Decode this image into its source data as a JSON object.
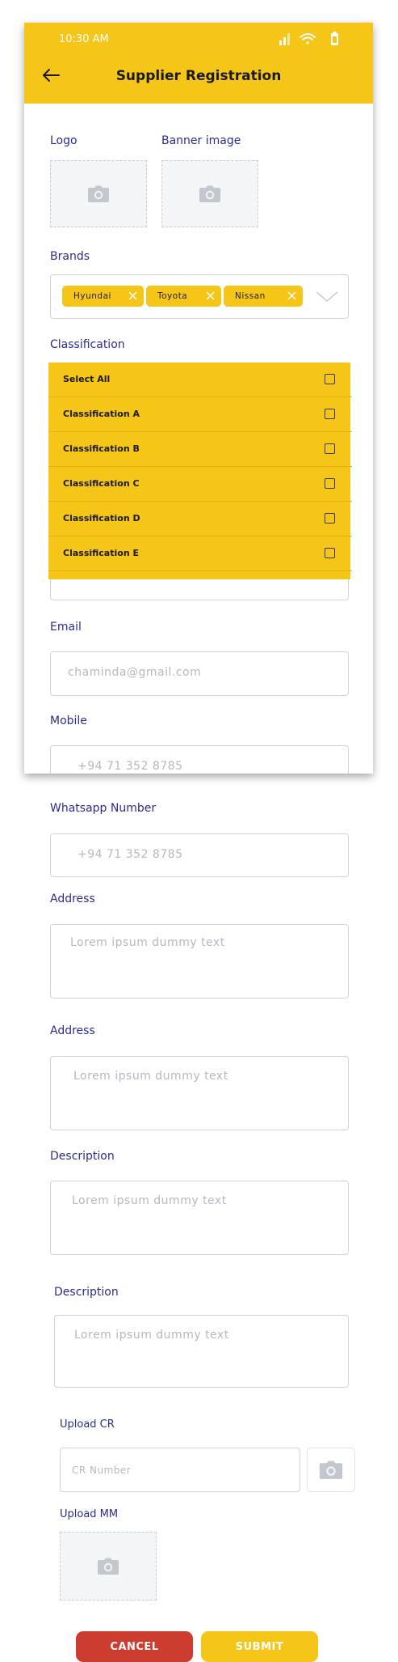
{
  "status": {
    "time": "10:30 AM"
  },
  "header": {
    "title": "Supplier Registration"
  },
  "form": {
    "logo_label": "Logo",
    "banner_label": "Banner image",
    "brands_label": "Brands",
    "brands": [
      "Hyundai",
      "Toyota",
      "Nissan"
    ],
    "classification_label": "Classification",
    "classification_options": [
      "Select All",
      "Classification A",
      "Classification B",
      "Classification C",
      "Classification D",
      "Classification E"
    ],
    "email_label": "Email",
    "email_placeholder": "chaminda@gmail.com",
    "mobile_label": "Mobile",
    "mobile_placeholder": "+94 71 352 8785",
    "whatsapp_label": "Whatsapp Number",
    "whatsapp_placeholder": "+94 71 352 8785",
    "address1_label": "Address",
    "address1_placeholder": "Lorem ipsum dummy text",
    "address2_label": "Address",
    "address2_placeholder": "Lorem ipsum dummy text",
    "description1_label": "Description",
    "description1_placeholder": "Lorem ipsum dummy text",
    "description2_label": "Description",
    "description2_placeholder": "Lorem ipsum dummy text",
    "upload_cr_label": "Upload CR",
    "cr_placeholder": "CR Number",
    "upload_mm_label": "Upload MM"
  },
  "actions": {
    "cancel_label": "CANCEL",
    "submit_label": "SUBMIT"
  },
  "colors": {
    "accent": "#f5c518",
    "label": "#2c2c8c",
    "cancel": "#cc3d2f"
  },
  "icons": [
    "back-arrow-icon",
    "signal-icon",
    "wifi-icon",
    "battery-icon",
    "camera-icon",
    "close-icon",
    "chevron-down-icon",
    "checkbox-icon"
  ]
}
